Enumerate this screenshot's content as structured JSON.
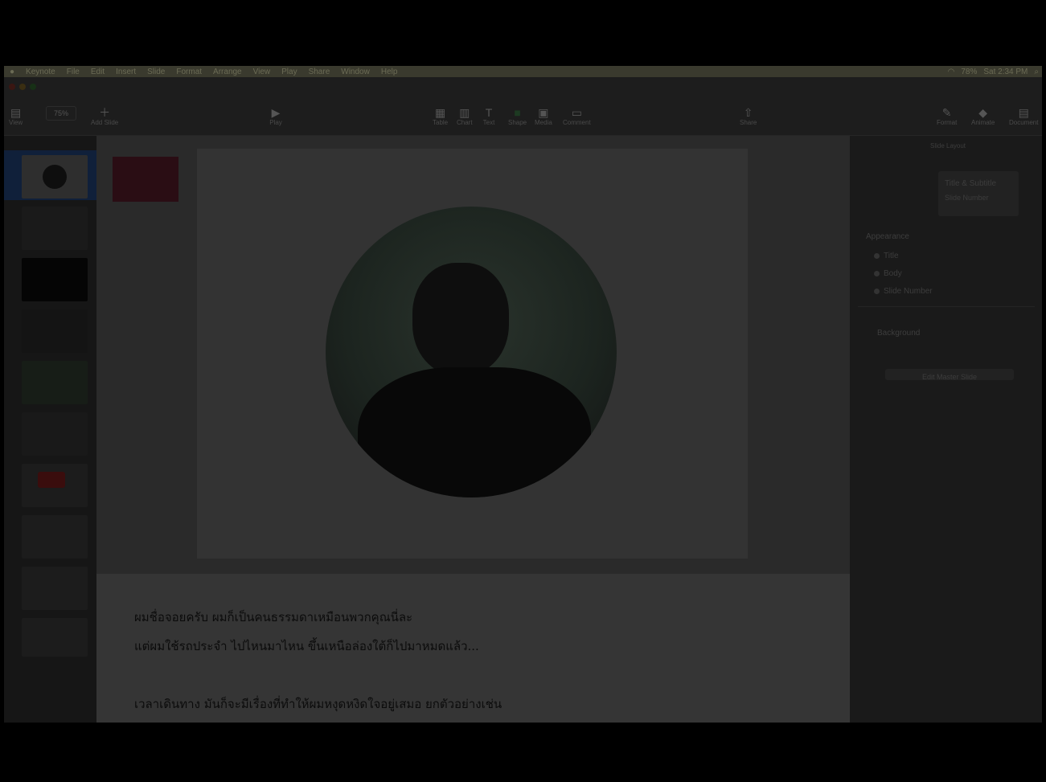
{
  "menu": {
    "apple": "",
    "items": [
      "Keynote",
      "File",
      "Edit",
      "Insert",
      "Slide",
      "Format",
      "Arrange",
      "View",
      "Play",
      "Share",
      "Window",
      "Help"
    ],
    "status": {
      "clock": "Sat 2:34 PM",
      "battery": "78%"
    }
  },
  "toolbar": {
    "view": "View",
    "zoom": "75%",
    "add_slide": "Add Slide",
    "play": "Play",
    "table": "Table",
    "chart": "Chart",
    "text": "Text",
    "shape": "Shape",
    "media": "Media",
    "comment": "Comment",
    "share": "Share",
    "format": "Format",
    "animate": "Animate",
    "document": "Document"
  },
  "inspector": {
    "tab": "Slide Layout",
    "layout_name": "Title & Subtitle",
    "layout_option": "Slide Number",
    "appearance_title": "Appearance",
    "options": [
      "Title",
      "Body",
      "Slide Number"
    ],
    "background_label": "Background",
    "edit_button": "Edit Master Slide"
  },
  "notes": {
    "line1": "ผมชื่อจอยครับ ผมก็เป็นคนธรรมดาเหมือนพวกคุณนี่ละ",
    "line2": "แต่ผมใช้รถประจำ ไปไหนมาไหน ขึ้นเหนือล่องใต้ก็ไปมาหมดแล้ว...",
    "line3": "เวลาเดินทาง มันก็จะมีเรื่องที่ทำให้ผมหงุดหงิดใจอยู่เสมอ ยกตัวอย่างเช่น"
  },
  "colors": {
    "accent": "#10203a",
    "notes_bg": "#353535",
    "canvas_bg": "#2a2a2a"
  }
}
